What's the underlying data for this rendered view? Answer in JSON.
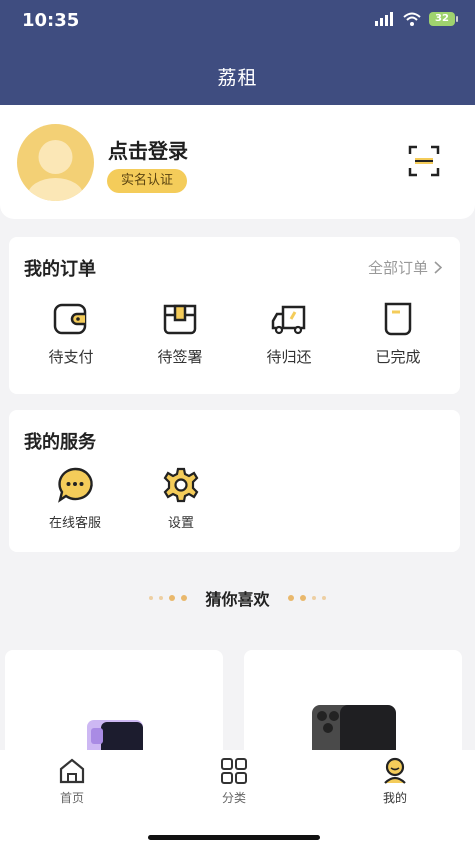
{
  "status_bar": {
    "time": "10:35",
    "battery": "32"
  },
  "header": {
    "title": "荔租"
  },
  "profile": {
    "login_text": "点击登录",
    "verify_label": "实名认证"
  },
  "orders": {
    "title": "我的订单",
    "all_label": "全部订单",
    "items": [
      {
        "label": "待支付",
        "icon": "wallet-icon"
      },
      {
        "label": "待签署",
        "icon": "package-icon"
      },
      {
        "label": "待归还",
        "icon": "truck-icon"
      },
      {
        "label": "已完成",
        "icon": "document-icon"
      }
    ]
  },
  "services": {
    "title": "我的服务",
    "items": [
      {
        "label": "在线客服",
        "icon": "chat-bubble-icon"
      },
      {
        "label": "设置",
        "icon": "gear-icon"
      }
    ]
  },
  "recommend": {
    "title": "猜你喜欢"
  },
  "tabbar": {
    "items": [
      {
        "label": "首页",
        "icon": "home-icon"
      },
      {
        "label": "分类",
        "icon": "grid-icon"
      },
      {
        "label": "我的",
        "icon": "profile-icon",
        "active": true
      }
    ]
  },
  "colors": {
    "header": "#3f4d80",
    "accent": "#f4cc5a",
    "background": "#f3f3f5"
  }
}
